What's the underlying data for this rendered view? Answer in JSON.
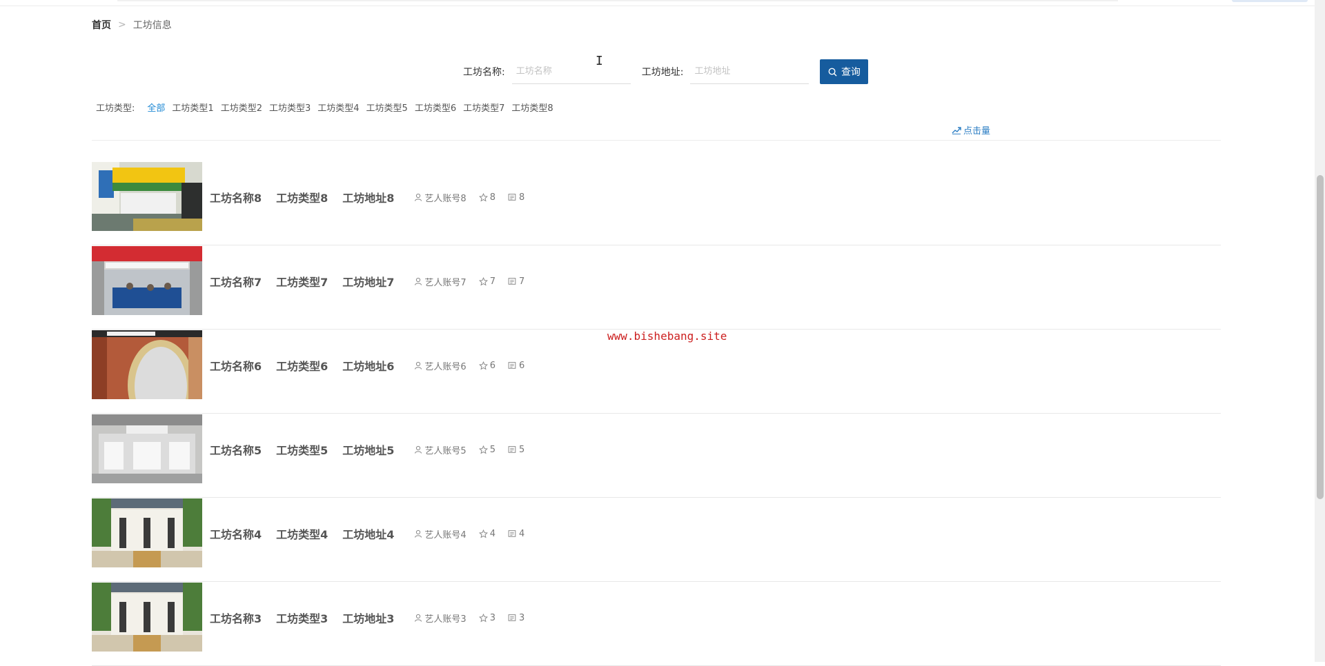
{
  "breadcrumb": {
    "home": "首页",
    "separator": ">",
    "current": "工坊信息"
  },
  "search": {
    "name_label": "工坊名称:",
    "name_placeholder": "工坊名称",
    "address_label": "工坊地址:",
    "address_placeholder": "工坊地址",
    "button_label": "查询",
    "button_color": "#165c9e"
  },
  "types": {
    "label": "工坊类型:",
    "items": [
      "全部",
      "工坊类型1",
      "工坊类型2",
      "工坊类型3",
      "工坊类型4",
      "工坊类型5",
      "工坊类型6",
      "工坊类型7",
      "工坊类型8"
    ],
    "active_index": 0,
    "active_color": "#1e88d4"
  },
  "sort": {
    "label": "点击量",
    "icon": "trend-chart-icon"
  },
  "rows": [
    {
      "name": "工坊名称8",
      "type": "工坊类型8",
      "address": "工坊地址8",
      "account": "艺人账号8",
      "favorites": "8",
      "comments": "8"
    },
    {
      "name": "工坊名称7",
      "type": "工坊类型7",
      "address": "工坊地址7",
      "account": "艺人账号7",
      "favorites": "7",
      "comments": "7"
    },
    {
      "name": "工坊名称6",
      "type": "工坊类型6",
      "address": "工坊地址6",
      "account": "艺人账号6",
      "favorites": "6",
      "comments": "6"
    },
    {
      "name": "工坊名称5",
      "type": "工坊类型5",
      "address": "工坊地址5",
      "account": "艺人账号5",
      "favorites": "5",
      "comments": "5"
    },
    {
      "name": "工坊名称4",
      "type": "工坊类型4",
      "address": "工坊地址4",
      "account": "艺人账号4",
      "favorites": "4",
      "comments": "4"
    },
    {
      "name": "工坊名称3",
      "type": "工坊类型3",
      "address": "工坊地址3",
      "account": "艺人账号3",
      "favorites": "3",
      "comments": "3"
    }
  ],
  "row_icons": {
    "account": "user-icon",
    "favorites": "star-icon",
    "comments": "comment-icon"
  },
  "watermark": "www.bishebang.site"
}
